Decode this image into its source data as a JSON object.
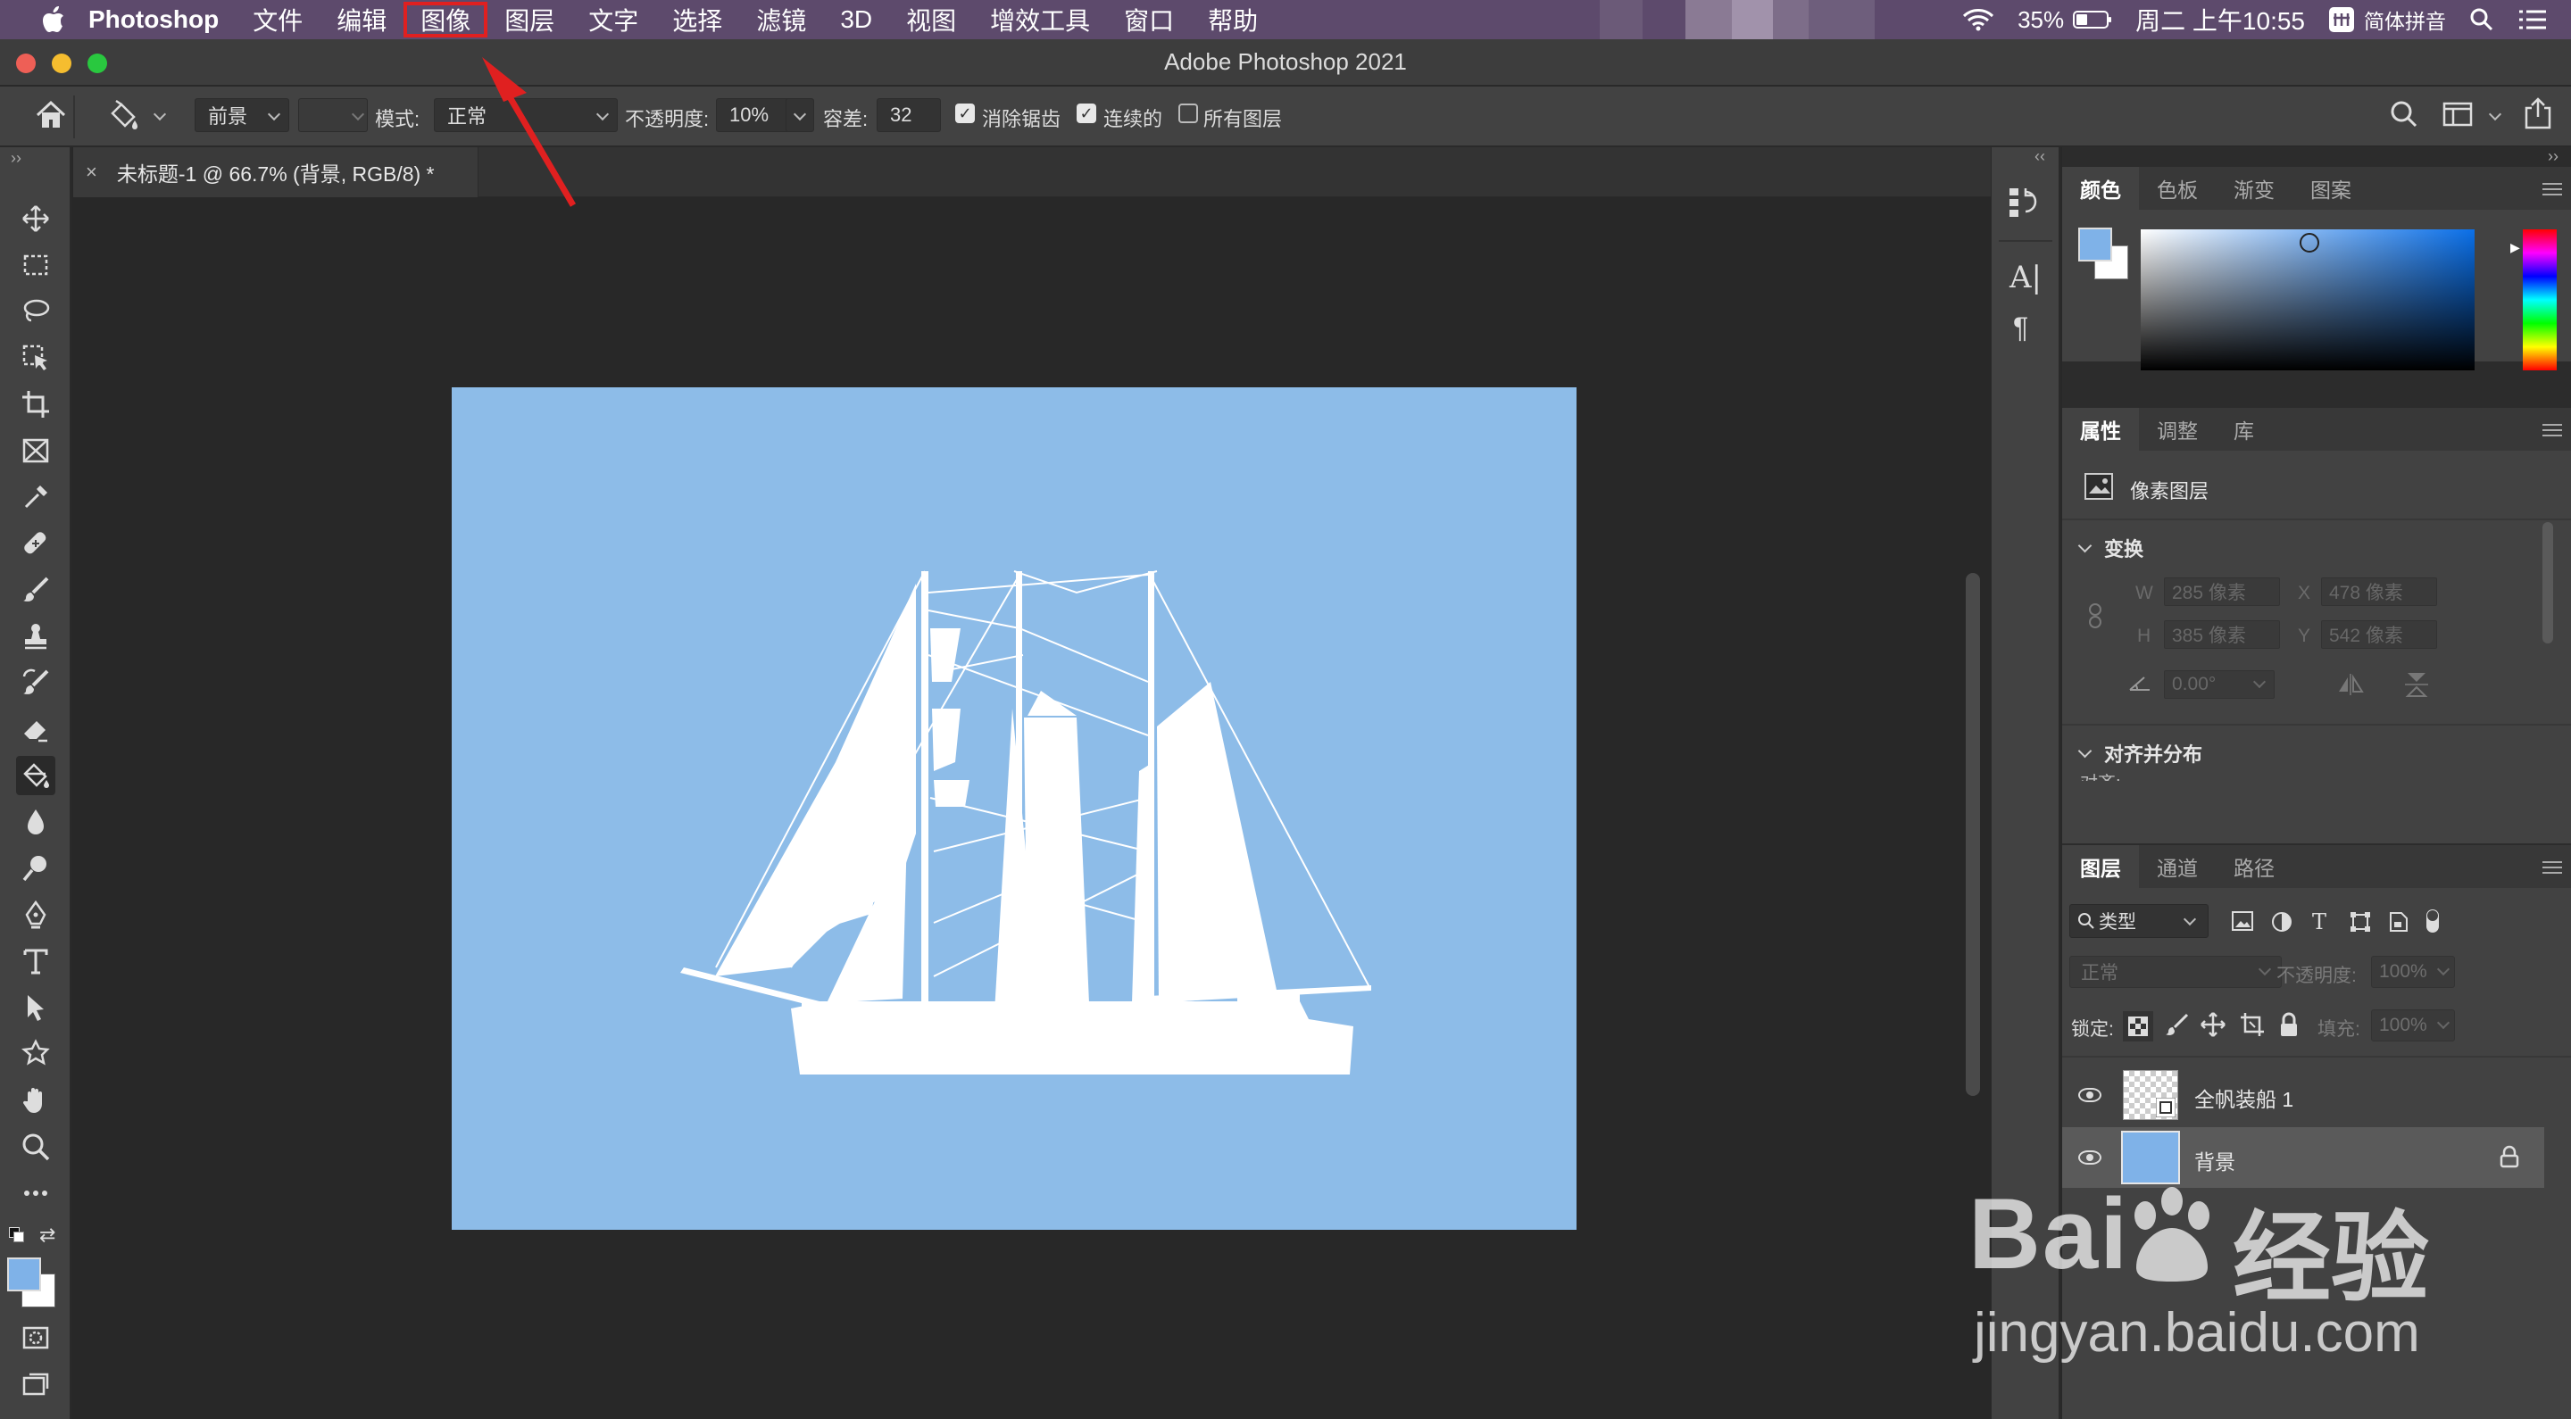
{
  "menubar": {
    "items": [
      "Photoshop",
      "文件",
      "编辑",
      "图像",
      "图层",
      "文字",
      "选择",
      "滤镜",
      "3D",
      "视图",
      "增效工具",
      "窗口",
      "帮助"
    ],
    "highlighted": "图像",
    "battery": "35%",
    "clock": "周二 上午10:55",
    "input_method": "简体拼音"
  },
  "window": {
    "title": "Adobe Photoshop 2021"
  },
  "options": {
    "fill_source": "前景",
    "mode_label": "模式:",
    "mode_value": "正常",
    "opacity_label": "不透明度:",
    "opacity_value": "10%",
    "tolerance_label": "容差:",
    "tolerance_value": "32",
    "antialias_label": "消除锯齿",
    "contiguous_label": "连续的",
    "all_layers_label": "所有图层"
  },
  "document": {
    "tab_title": "未标题-1 @ 66.7% (背景, RGB/8) *",
    "background_color": "#8dbce8",
    "shape_color": "#ffffff"
  },
  "colors": {
    "foreground": "#7fb2e8",
    "background": "#ffffff",
    "highlight": "#e02020"
  },
  "color_panel": {
    "tabs": [
      "颜色",
      "色板",
      "渐变",
      "图案"
    ],
    "active": "颜色"
  },
  "properties_panel": {
    "tabs": [
      "属性",
      "调整",
      "库"
    ],
    "active": "属性",
    "layer_type": "像素图层",
    "transform_title": "变换",
    "w_label": "W",
    "w_value": "285 像素",
    "x_label": "X",
    "x_value": "478 像素",
    "h_label": "H",
    "h_value": "385 像素",
    "y_label": "Y",
    "y_value": "542 像素",
    "angle_value": "0.00°",
    "align_title": "对齐并分布",
    "align_sub": "对齐:"
  },
  "layers_panel": {
    "tabs": [
      "图层",
      "通道",
      "路径"
    ],
    "active": "图层",
    "filter": "类型",
    "blend": "正常",
    "opacity_label": "不透明度:",
    "opacity_value": "100%",
    "lock_label": "锁定:",
    "fill_label": "填充:",
    "fill_value": "100%",
    "layers": [
      {
        "name": "全帆装船 1",
        "visible": true
      },
      {
        "name": "背景",
        "visible": true,
        "locked": true
      }
    ]
  },
  "watermark": {
    "brand": "Bai",
    "brand_cn": "经验",
    "url": "jingyan.baidu.com"
  }
}
